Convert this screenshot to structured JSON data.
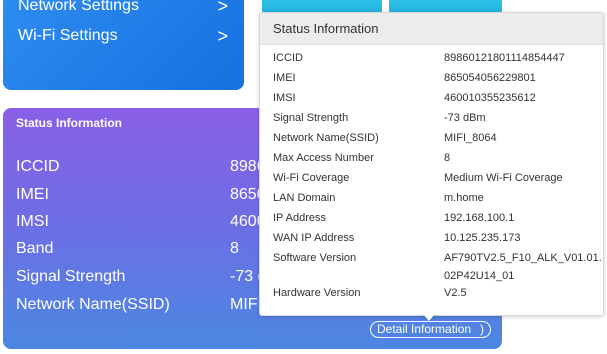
{
  "settings": {
    "network_settings_label": "Network Settings",
    "wifi_settings_label": "Wi-Fi Settings",
    "chevron": ">"
  },
  "status_card": {
    "title": "Status Information",
    "rows": [
      {
        "label": "ICCID",
        "value": "8986"
      },
      {
        "label": "IMEI",
        "value": "8650"
      },
      {
        "label": "IMSI",
        "value": "4600"
      },
      {
        "label": "Band",
        "value": "8"
      },
      {
        "label": "Signal Strength",
        "value": "-73 d"
      },
      {
        "label": "Network Name(SSID)",
        "value": "MIFI"
      }
    ],
    "detail_button_label": "Detail Information",
    "detail_button_arrow": ")"
  },
  "popup": {
    "title": "Status Information",
    "rows": [
      {
        "label": "ICCID",
        "value": "89860121801114854447"
      },
      {
        "label": "IMEI",
        "value": "865054056229801"
      },
      {
        "label": "IMSI",
        "value": "460010355235612"
      },
      {
        "label": "Signal Strength",
        "value": "-73 dBm"
      },
      {
        "label": "Network Name(SSID)",
        "value": "MIFI_8064"
      },
      {
        "label": "Max Access Number",
        "value": "8"
      },
      {
        "label": "Wi-Fi Coverage",
        "value": "Medium Wi-Fi Coverage"
      },
      {
        "label": "LAN Domain",
        "value": "m.home"
      },
      {
        "label": "IP Address",
        "value": "192.168.100.1"
      },
      {
        "label": "WAN IP Address",
        "value": "10.125.235.173"
      },
      {
        "label": "Software Version",
        "value": "AF790TV2.5_F10_ALK_V01.01.02P42U14_01"
      },
      {
        "label": "Hardware Version",
        "value": "V2.5"
      }
    ]
  },
  "colors": {
    "settings_card_blue": "#1f7fe8",
    "status_card_gradient_top": "#8a5fe8",
    "status_card_gradient_bottom": "#4b87e2",
    "tile_cyan": "#2cc2e9",
    "popup_header_gray": "#ececec"
  },
  "icons": {
    "chevron": "chevron-right-icon",
    "detail_arrow": "arrow-right-icon"
  }
}
